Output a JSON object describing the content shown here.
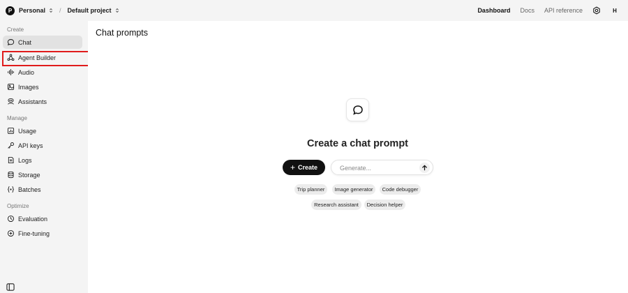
{
  "topbar": {
    "org_initial": "P",
    "org_name": "Personal",
    "separator": "/",
    "project_name": "Default project",
    "nav": [
      "Dashboard",
      "Docs",
      "API reference"
    ],
    "settings_icon": "gear-icon",
    "user_initial": "H"
  },
  "sidebar": {
    "sections": [
      {
        "label": "Create",
        "items": [
          {
            "label": "Chat",
            "icon": "chat-bubble-icon",
            "active": true
          },
          {
            "label": "Agent Builder",
            "icon": "agent-builder-icon",
            "highlighted": true
          },
          {
            "label": "Audio",
            "icon": "audio-waveform-icon"
          },
          {
            "label": "Images",
            "icon": "image-icon"
          },
          {
            "label": "Assistants",
            "icon": "assistants-icon"
          }
        ]
      },
      {
        "label": "Manage",
        "items": [
          {
            "label": "Usage",
            "icon": "usage-chart-icon"
          },
          {
            "label": "API keys",
            "icon": "key-icon"
          },
          {
            "label": "Logs",
            "icon": "logs-icon"
          },
          {
            "label": "Storage",
            "icon": "storage-icon"
          },
          {
            "label": "Batches",
            "icon": "batches-icon"
          }
        ]
      },
      {
        "label": "Optimize",
        "items": [
          {
            "label": "Evaluation",
            "icon": "evaluation-icon"
          },
          {
            "label": "Fine-tuning",
            "icon": "fine-tuning-icon"
          }
        ]
      }
    ],
    "toggle_icon": "sidebar-toggle-icon"
  },
  "main": {
    "title": "Chat prompts",
    "empty_state": {
      "icon": "chat-bubble-icon",
      "heading": "Create a chat prompt",
      "create_button": "Create",
      "generate_placeholder": "Generate...",
      "suggestions_row1": [
        "Trip planner",
        "Image generator",
        "Code debugger"
      ],
      "suggestions_row2": [
        "Research assistant",
        "Decision helper"
      ]
    }
  },
  "colors": {
    "sidebar_bg": "#f4f4f4",
    "main_bg": "#ffffff",
    "primary_button": "#111111",
    "highlight_outline": "#e01b1b"
  }
}
